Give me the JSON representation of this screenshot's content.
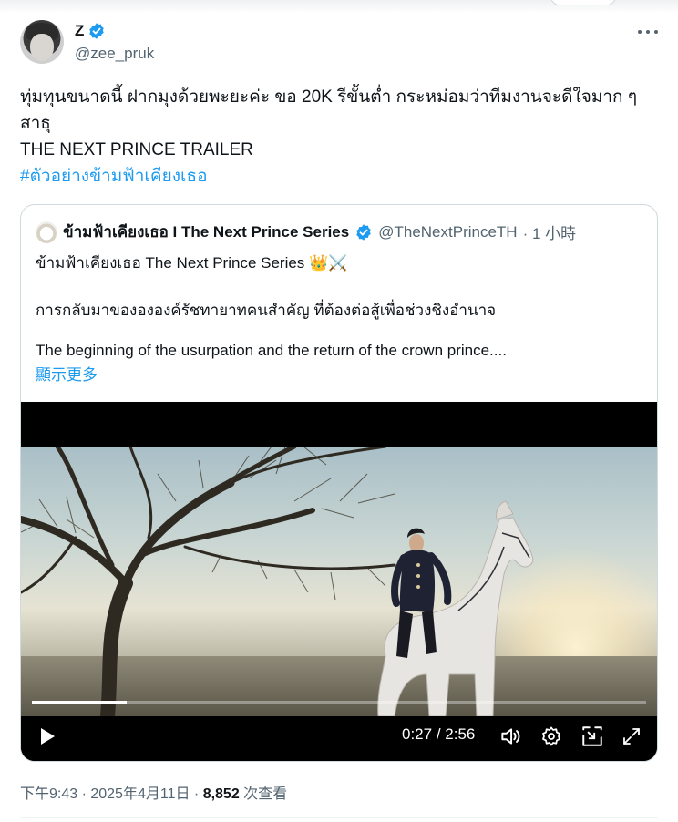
{
  "author": {
    "name": "Z",
    "handle": "@zee_pruk"
  },
  "tweet": {
    "line1": "ทุ่มทุนขนาดนี้ ฝากมุงด้วยพะยะค่ะ ขอ 20K รีขั้นต่ำ กระหม่อมว่าทีมงานจะดีใจมาก ๆ",
    "line2": "สาธุ",
    "line3": "THE NEXT PRINCE TRAILER",
    "hashtag": "#ตัวอย่างข้ามฟ้าเคียงเธอ"
  },
  "quote": {
    "name": "ข้ามฟ้าเคียงเธอ I The Next Prince Series",
    "handle": "@TheNextPrinceTH",
    "time": "· 1 小時",
    "line1": "ข้ามฟ้าเคียงเธอ The Next Prince Series 👑⚔️",
    "line2": "การกลับมาของององค์รัชทายาทคนสำคัญ ที่ต้องต่อสู้เพื่อช่วงชิงอำนาจ",
    "line3": "The beginning of the usurpation and the return of the crown prince....",
    "show_more": "顯示更多"
  },
  "video": {
    "current": "0:27",
    "separator": "/",
    "duration": "2:56",
    "progress": 0.155
  },
  "meta": {
    "time": "下午9:43 · 2025年4月11日 · ",
    "views": "8,852",
    "views_label": " 次查看"
  },
  "colors": {
    "accent": "#1d9bf0",
    "text": "#0f1419",
    "secondary": "#536471"
  }
}
